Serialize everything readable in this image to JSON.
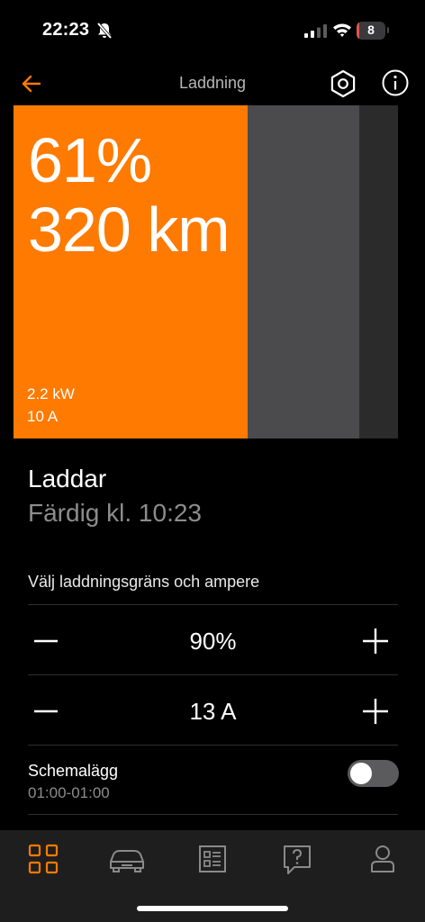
{
  "status_bar": {
    "time": "22:23",
    "battery_level": "8"
  },
  "header": {
    "title": "Laddning"
  },
  "charge": {
    "percent_label": "61%",
    "range_label": "320 km",
    "power": "2.2 kW",
    "current": "10 A",
    "state_of_charge": 0.61,
    "charge_limit": 0.9
  },
  "status": {
    "state": "Laddar",
    "finish": "Färdig kl. 10:23"
  },
  "limits": {
    "section_label": "Välj laddningsgräns och ampere",
    "charge_limit_value": "90%",
    "amperage_value": "13 A"
  },
  "schedule": {
    "label": "Schemalägg",
    "time_range": "01:00-01:00",
    "enabled": false
  },
  "tabs": [
    {
      "icon": "grid-icon",
      "active": true
    },
    {
      "icon": "car-icon",
      "active": false
    },
    {
      "icon": "list-icon",
      "active": false
    },
    {
      "icon": "help-icon",
      "active": false
    },
    {
      "icon": "profile-icon",
      "active": false
    }
  ],
  "colors": {
    "accent": "#ff7a00",
    "background": "#000000",
    "panel_bg": "#2b2b2b",
    "limit_area": "#4b4b4d",
    "secondary_text": "#8c8c8c",
    "tab_bar_bg": "#1e1e1e",
    "tab_inactive": "#8a8a8a"
  }
}
